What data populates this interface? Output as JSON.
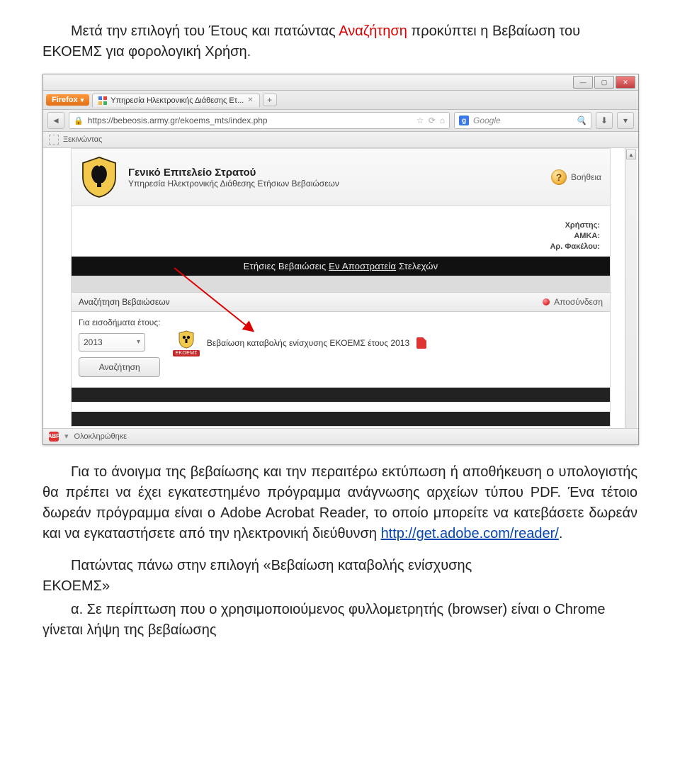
{
  "doc": {
    "p1_a": "Μετά την επιλογή του Έτους και πατώντας ",
    "p1_red": "Αναζήτηση",
    "p1_b": " προκύπτει η Βεβαίωση του ΕΚΟΕΜΣ για φορολογική Χρήση.",
    "p2_a": "Για το άνοιγμα της βεβαίωσης και την περαιτέρω εκτύπωση ή αποθήκευση ο υπολογιστής θα πρέπει να έχει εγκατεστημένο πρόγραμμα ανάγνωσης αρχείων τύπου PDF. Ένα τέτοιο δωρεάν πρόγραμμα είναι ο Adobe Acrobat Reader, το οποίο μπορείτε να κατεβάσετε δωρεάν και να εγκαταστήσετε από την ηλεκτρονική διεύθυνση ",
    "p2_link": "http://get.adobe.com/reader/",
    "p2_b": ".",
    "p3_left": "ΕΚΟΕΜΣ»",
    "p3_right": "Πατώντας πάνω στην επιλογή «Βεβαίωση καταβολής ενίσχυσης",
    "p4": "α.   Σε περίπτωση που ο χρησιμοποιούμενος φυλλομετρητής (browser) είναι ο Chrome γίνεται λήψη της βεβαίωσης"
  },
  "browser": {
    "identity": "Firefox",
    "tab_title": "Υπηρεσία Ηλεκτρονικής Διάθεσης Ετ...",
    "url": "https://bebeosis.army.gr/ekoems_mts/index.php",
    "search_placeholder": "Google",
    "bookmark": "Ξεκινώντας",
    "status": "Ολοκληρώθηκε"
  },
  "site": {
    "header_title": "Γενικό Επιτελείο Στρατού",
    "header_subtitle": "Υπηρεσία Ηλεκτρονικής Διάθεσης Ετήσιων Βεβαιώσεων",
    "help": "Βοήθεια",
    "user_labels": {
      "user": "Χρήστης:",
      "amka": "ΑΜΚΑ:",
      "fakelos": "Αρ. Φακέλου:"
    },
    "page_title_a": "Ετήσιες Βεβαιώσεις ",
    "page_title_b": "Εν Αποστρατεία",
    "page_title_c": " Στελεχών",
    "tool_search": "Αναζήτηση Βεβαιώσεων",
    "tool_logout": "Αποσύνδεση",
    "year_label": "Για εισοδήματα έτους:",
    "year_value": "2013",
    "search_btn": "Αναζήτηση",
    "ekoems_tag": "EKOEMΣ",
    "result_text": "Βεβαίωση καταβολής ενίσχυσης ΕΚΟΕΜΣ έτους 2013"
  }
}
